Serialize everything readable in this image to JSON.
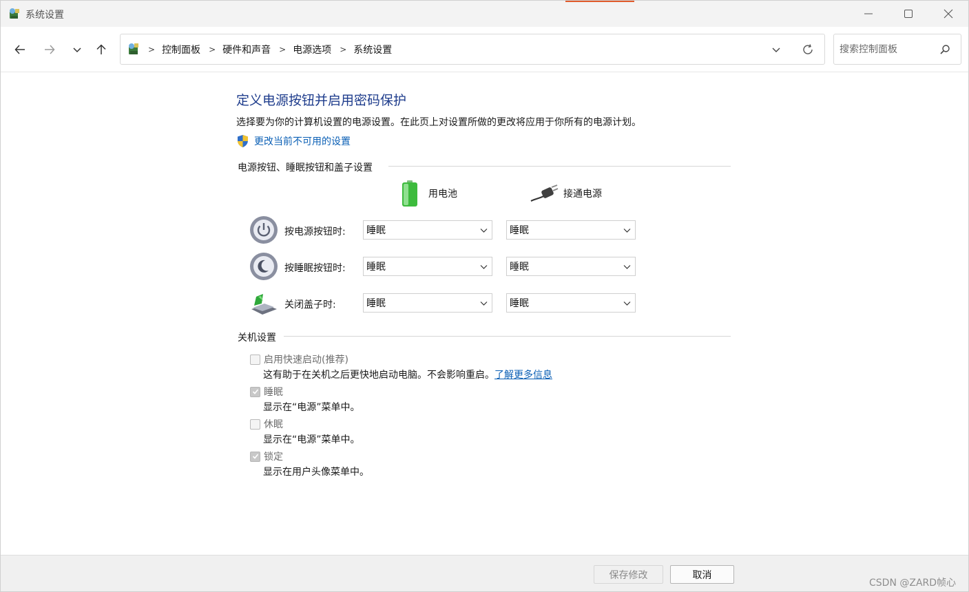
{
  "window": {
    "title": "系统设置",
    "accent_color": "#e05a2b"
  },
  "nav": {
    "breadcrumbs": [
      "控制面板",
      "硬件和声音",
      "电源选项",
      "系统设置"
    ],
    "search_placeholder": "搜索控制面板"
  },
  "page": {
    "heading": "定义电源按钮并启用密码保护",
    "description": "选择要为你的计算机设置的电源设置。在此页上对设置所做的更改将应用于你所有的电源计划。",
    "admin_link": "更改当前不可用的设置"
  },
  "power_buttons": {
    "section_title": "电源按钮、睡眠按钮和盖子设置",
    "columns": [
      "用电池",
      "接通电源"
    ],
    "rows": [
      {
        "label": "按电源按钮时:",
        "battery": "睡眠",
        "plugged": "睡眠",
        "icon": "power-button-icon"
      },
      {
        "label": "按睡眠按钮时:",
        "battery": "睡眠",
        "plugged": "睡眠",
        "icon": "sleep-button-icon"
      },
      {
        "label": "关闭盖子时:",
        "battery": "睡眠",
        "plugged": "睡眠",
        "icon": "laptop-lid-icon"
      }
    ]
  },
  "shutdown": {
    "section_title": "关机设置",
    "options": [
      {
        "label": "启用快速启动(推荐)",
        "checked": false,
        "desc": "这有助于在关机之后更快地启动电脑。不会影响重启。",
        "link": "了解更多信息"
      },
      {
        "label": "睡眠",
        "checked": true,
        "desc": "显示在“电源”菜单中。"
      },
      {
        "label": "休眠",
        "checked": false,
        "desc": "显示在“电源”菜单中。"
      },
      {
        "label": "锁定",
        "checked": true,
        "desc": "显示在用户头像菜单中。"
      }
    ]
  },
  "footer": {
    "save_label": "保存修改",
    "cancel_label": "取消",
    "watermark": "CSDN @ZARD帧心"
  }
}
